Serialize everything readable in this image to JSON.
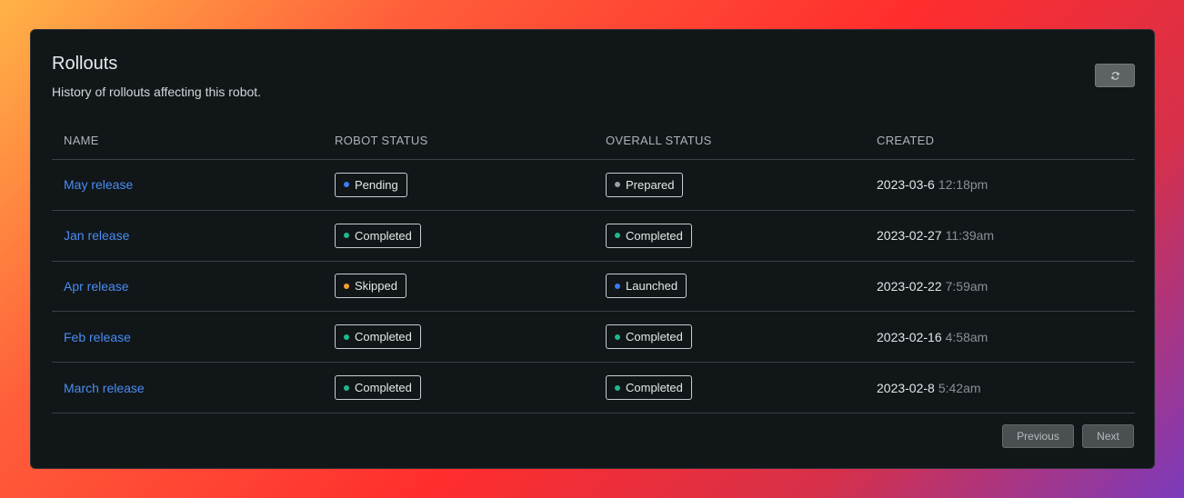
{
  "header": {
    "title": "Rollouts",
    "subtitle": "History of rollouts affecting this robot.",
    "refresh_icon": "refresh-icon"
  },
  "columns": [
    "NAME",
    "ROBOT STATUS",
    "OVERALL STATUS",
    "CREATED"
  ],
  "colors": {
    "blue": "#3b7cf0",
    "green": "#1fb98a",
    "orange": "#f39c2b",
    "gray": "#9aa0a4"
  },
  "rows": [
    {
      "name": "May release",
      "robot_status": {
        "label": "Pending",
        "color": "#3b7cf0"
      },
      "overall_status": {
        "label": "Prepared",
        "color": "#9aa0a4"
      },
      "date": "2023-03-6",
      "time": "12:18pm"
    },
    {
      "name": "Jan release",
      "robot_status": {
        "label": "Completed",
        "color": "#1fb98a"
      },
      "overall_status": {
        "label": "Completed",
        "color": "#1fb98a"
      },
      "date": "2023-02-27",
      "time": "11:39am"
    },
    {
      "name": "Apr release",
      "robot_status": {
        "label": "Skipped",
        "color": "#f39c2b"
      },
      "overall_status": {
        "label": "Launched",
        "color": "#3b7cf0"
      },
      "date": "2023-02-22",
      "time": "7:59am"
    },
    {
      "name": "Feb release",
      "robot_status": {
        "label": "Completed",
        "color": "#1fb98a"
      },
      "overall_status": {
        "label": "Completed",
        "color": "#1fb98a"
      },
      "date": "2023-02-16",
      "time": "4:58am"
    },
    {
      "name": "March release",
      "robot_status": {
        "label": "Completed",
        "color": "#1fb98a"
      },
      "overall_status": {
        "label": "Completed",
        "color": "#1fb98a"
      },
      "date": "2023-02-8",
      "time": "5:42am"
    }
  ],
  "pagination": {
    "previous": "Previous",
    "next": "Next"
  }
}
